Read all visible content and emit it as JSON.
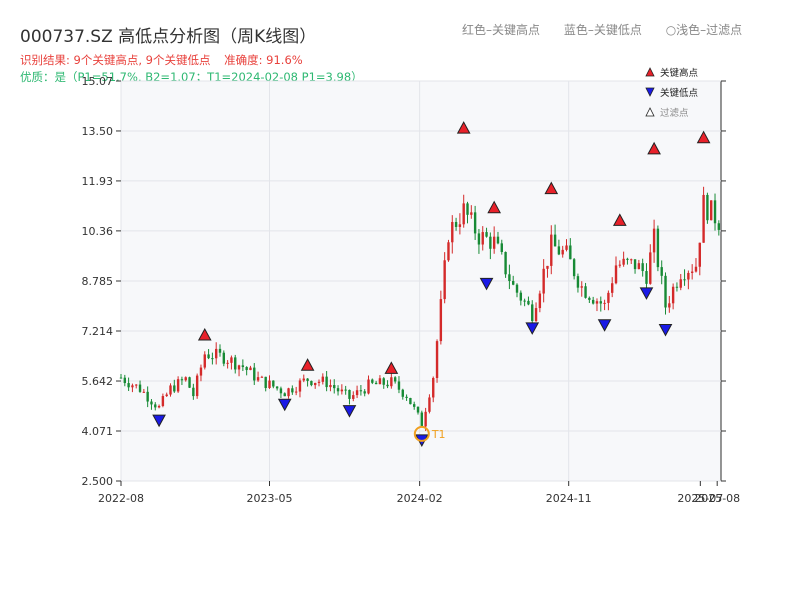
{
  "header": {
    "title": "000737.SZ 高低点分析图（周K线图）",
    "result_text": "识别结果: 9个关键高点, 9个关键低点",
    "accuracy_text": "准确度: 91.6%",
    "quality_text": "优质：是（P1=51.7%, B2=1.07；T1=2024-02-08 P1=3.98）"
  },
  "top_legend": {
    "red": "红色–关键高点",
    "blue": "蓝色–关键低点",
    "light": "浅色–过滤点",
    "circle_glyph": "○"
  },
  "chart_data": {
    "type": "candlestick",
    "x_ticks": [
      "2022-08",
      "2023-05",
      "2024-02",
      "2024-11",
      "2025-07",
      "2025-08"
    ],
    "y_ticks": [
      "2.500",
      "4.071",
      "5.642",
      "7.214",
      "8.785",
      "10.36",
      "11.93",
      "13.50",
      "15.07"
    ],
    "y_range": [
      2.5,
      15.07
    ],
    "date_range": [
      "2022-08-01",
      "2025-08-08"
    ],
    "legend": [
      {
        "name": "关键高点",
        "color": "#e8212a"
      },
      {
        "name": "关键低点",
        "color": "#1a1ae6"
      },
      {
        "name": "过滤点",
        "color": "#ffffff"
      }
    ],
    "key_highs": [
      {
        "date": "2023-01-02",
        "price": 6.9
      },
      {
        "date": "2023-07-10",
        "price": 5.95
      },
      {
        "date": "2023-12-11",
        "price": 5.85
      },
      {
        "date": "2024-04-22",
        "price": 13.4
      },
      {
        "date": "2024-06-17",
        "price": 10.9
      },
      {
        "date": "2024-09-30",
        "price": 11.5
      },
      {
        "date": "2025-02-03",
        "price": 10.5
      },
      {
        "date": "2025-04-07",
        "price": 12.75
      },
      {
        "date": "2025-07-07",
        "price": 13.1
      }
    ],
    "key_lows": [
      {
        "date": "2022-10-10",
        "price": 4.6
      },
      {
        "date": "2023-05-29",
        "price": 5.1
      },
      {
        "date": "2023-09-25",
        "price": 4.9
      },
      {
        "date": "2024-02-05",
        "price": 3.98
      },
      {
        "date": "2024-06-03",
        "price": 8.9
      },
      {
        "date": "2024-08-26",
        "price": 7.5
      },
      {
        "date": "2025-01-06",
        "price": 7.6
      },
      {
        "date": "2025-03-24",
        "price": 8.6
      },
      {
        "date": "2025-04-28",
        "price": 7.45
      }
    ],
    "t1_marker": {
      "label": "T1",
      "date": "2024-02-05",
      "price": 3.98
    },
    "price_path": [
      [
        "2022-08-01",
        5.75
      ],
      [
        "2022-09-05",
        5.4
      ],
      [
        "2022-10-10",
        4.8
      ],
      [
        "2022-10-31",
        5.4
      ],
      [
        "2022-11-28",
        5.7
      ],
      [
        "2022-12-12",
        5.2
      ],
      [
        "2023-01-02",
        6.5
      ],
      [
        "2023-02-06",
        6.4
      ],
      [
        "2023-03-13",
        6.1
      ],
      [
        "2023-04-10",
        5.7
      ],
      [
        "2023-05-29",
        5.3
      ],
      [
        "2023-07-10",
        5.7
      ],
      [
        "2023-08-14",
        5.6
      ],
      [
        "2023-09-25",
        5.1
      ],
      [
        "2023-10-30",
        5.5
      ],
      [
        "2023-12-11",
        5.6
      ],
      [
        "2024-01-08",
        5.2
      ],
      [
        "2024-02-05",
        4.3
      ],
      [
        "2024-02-26",
        5.8
      ],
      [
        "2024-03-11",
        8.0
      ],
      [
        "2024-03-25",
        10.3
      ],
      [
        "2024-04-22",
        11.0
      ],
      [
        "2024-05-20",
        10.2
      ],
      [
        "2024-06-17",
        10.0
      ],
      [
        "2024-07-22",
        8.6
      ],
      [
        "2024-08-26",
        7.8
      ],
      [
        "2024-09-30",
        9.9
      ],
      [
        "2024-10-28",
        9.6
      ],
      [
        "2024-11-25",
        8.6
      ],
      [
        "2024-12-23",
        8.2
      ],
      [
        "2025-01-06",
        8.0
      ],
      [
        "2025-01-27",
        9.3
      ],
      [
        "2025-03-03",
        9.3
      ],
      [
        "2025-03-24",
        9.0
      ],
      [
        "2025-04-07",
        10.1
      ],
      [
        "2025-04-28",
        8.0
      ],
      [
        "2025-05-26",
        9.1
      ],
      [
        "2025-06-23",
        9.3
      ],
      [
        "2025-07-07",
        11.2
      ],
      [
        "2025-08-08",
        10.6
      ]
    ]
  }
}
